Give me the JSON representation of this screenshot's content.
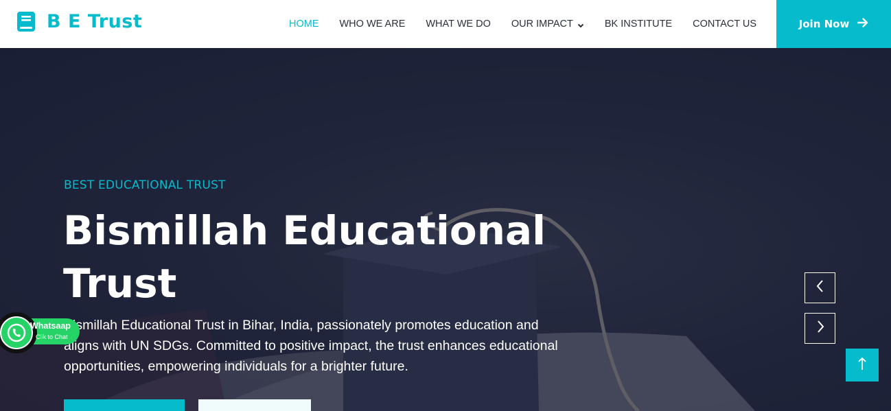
{
  "brand": {
    "name": "B E Trust",
    "color": "#06bbcc",
    "icon": "book-icon"
  },
  "nav": {
    "items": [
      {
        "label": "HOME",
        "active": true
      },
      {
        "label": "WHO WE ARE"
      },
      {
        "label": "WHAT WE DO"
      },
      {
        "label": "OUR IMPACT",
        "icon": "chevron-down-icon"
      },
      {
        "label": "BK INSTITUTE"
      },
      {
        "label": "CONTACT US"
      }
    ],
    "cta": {
      "label": "Join Now",
      "icon": "arrow-right-icon"
    }
  },
  "hero": {
    "subtitle": "BEST EDUCATIONAL TRUST",
    "title_line1": "Bismillah Educational",
    "title_line2": "Trust",
    "description": "Bismillah Educational Trust in Bihar, India, passionately promotes education and aligns with UN SDGs. Committed to positive impact, the trust enhances educational opportunities, empowering individuals for a brighter future.",
    "carousel": {
      "prev_icon": "chevron-left-icon",
      "next_icon": "chevron-right-icon"
    },
    "back_to_top_icon": "arrow-up-icon"
  },
  "whatsapp": {
    "label": "Whatsaap",
    "sublabel": "Clik to Chat",
    "color": "#25d366",
    "icon": "whatsapp-icon"
  }
}
